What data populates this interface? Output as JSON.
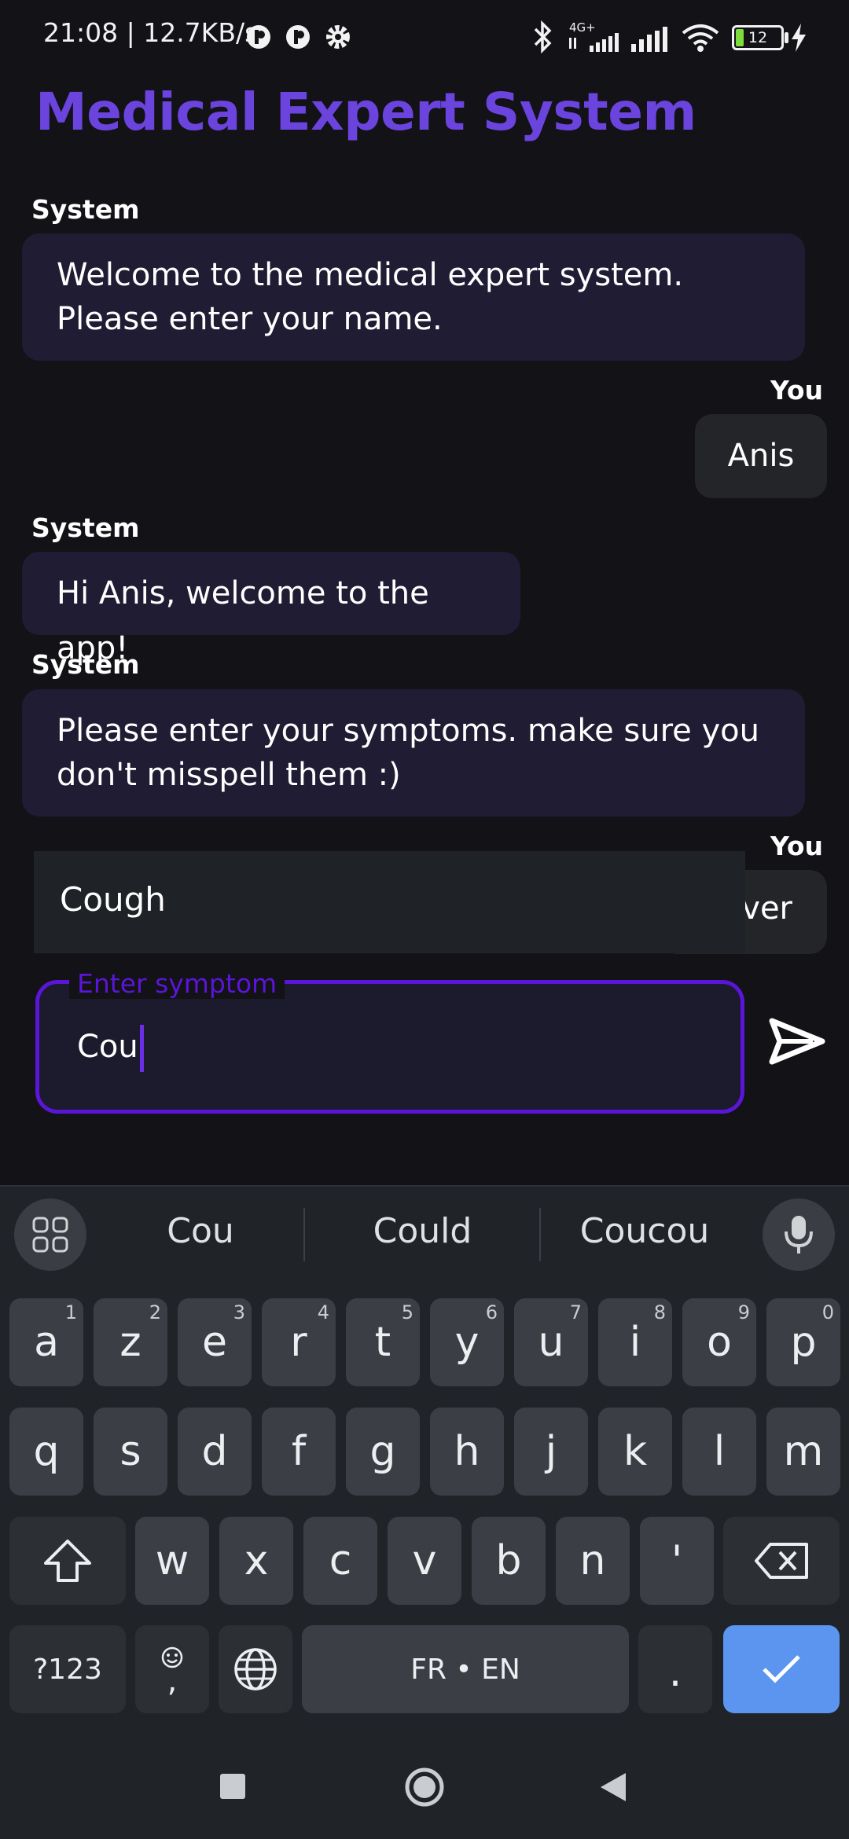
{
  "status_bar": {
    "time_speed": "21:08 | 12.7KB/s",
    "network": "4G+",
    "battery": "12"
  },
  "app": {
    "title": "Medical Expert System"
  },
  "chat": {
    "messages": [
      {
        "sender": "System",
        "text": "Welcome to the medical expert system. Please enter your name."
      },
      {
        "sender": "You",
        "text": "Anis"
      },
      {
        "sender": "System",
        "text": "Hi Anis, welcome to the app!"
      },
      {
        "sender": "System",
        "text": "Please enter your symptoms. make sure you don't misspell them :)"
      },
      {
        "sender": "You",
        "text": "ver"
      }
    ]
  },
  "autocomplete": {
    "option": "Cough"
  },
  "input": {
    "label": "Enter symptom",
    "value": "Cou"
  },
  "keyboard": {
    "suggestions": [
      "Cou",
      "Could",
      "Coucou"
    ],
    "row1": [
      {
        "key": "a",
        "hint": "1"
      },
      {
        "key": "z",
        "hint": "2"
      },
      {
        "key": "e",
        "hint": "3"
      },
      {
        "key": "r",
        "hint": "4"
      },
      {
        "key": "t",
        "hint": "5"
      },
      {
        "key": "y",
        "hint": "6"
      },
      {
        "key": "u",
        "hint": "7"
      },
      {
        "key": "i",
        "hint": "8"
      },
      {
        "key": "o",
        "hint": "9"
      },
      {
        "key": "p",
        "hint": "0"
      }
    ],
    "row2": [
      "q",
      "s",
      "d",
      "f",
      "g",
      "h",
      "j",
      "k",
      "l",
      "m"
    ],
    "row3": [
      "w",
      "x",
      "c",
      "v",
      "b",
      "n",
      "'"
    ],
    "symbols_label": "?123",
    "comma_label": ",",
    "space_label": "FR • EN",
    "period_label": "."
  }
}
